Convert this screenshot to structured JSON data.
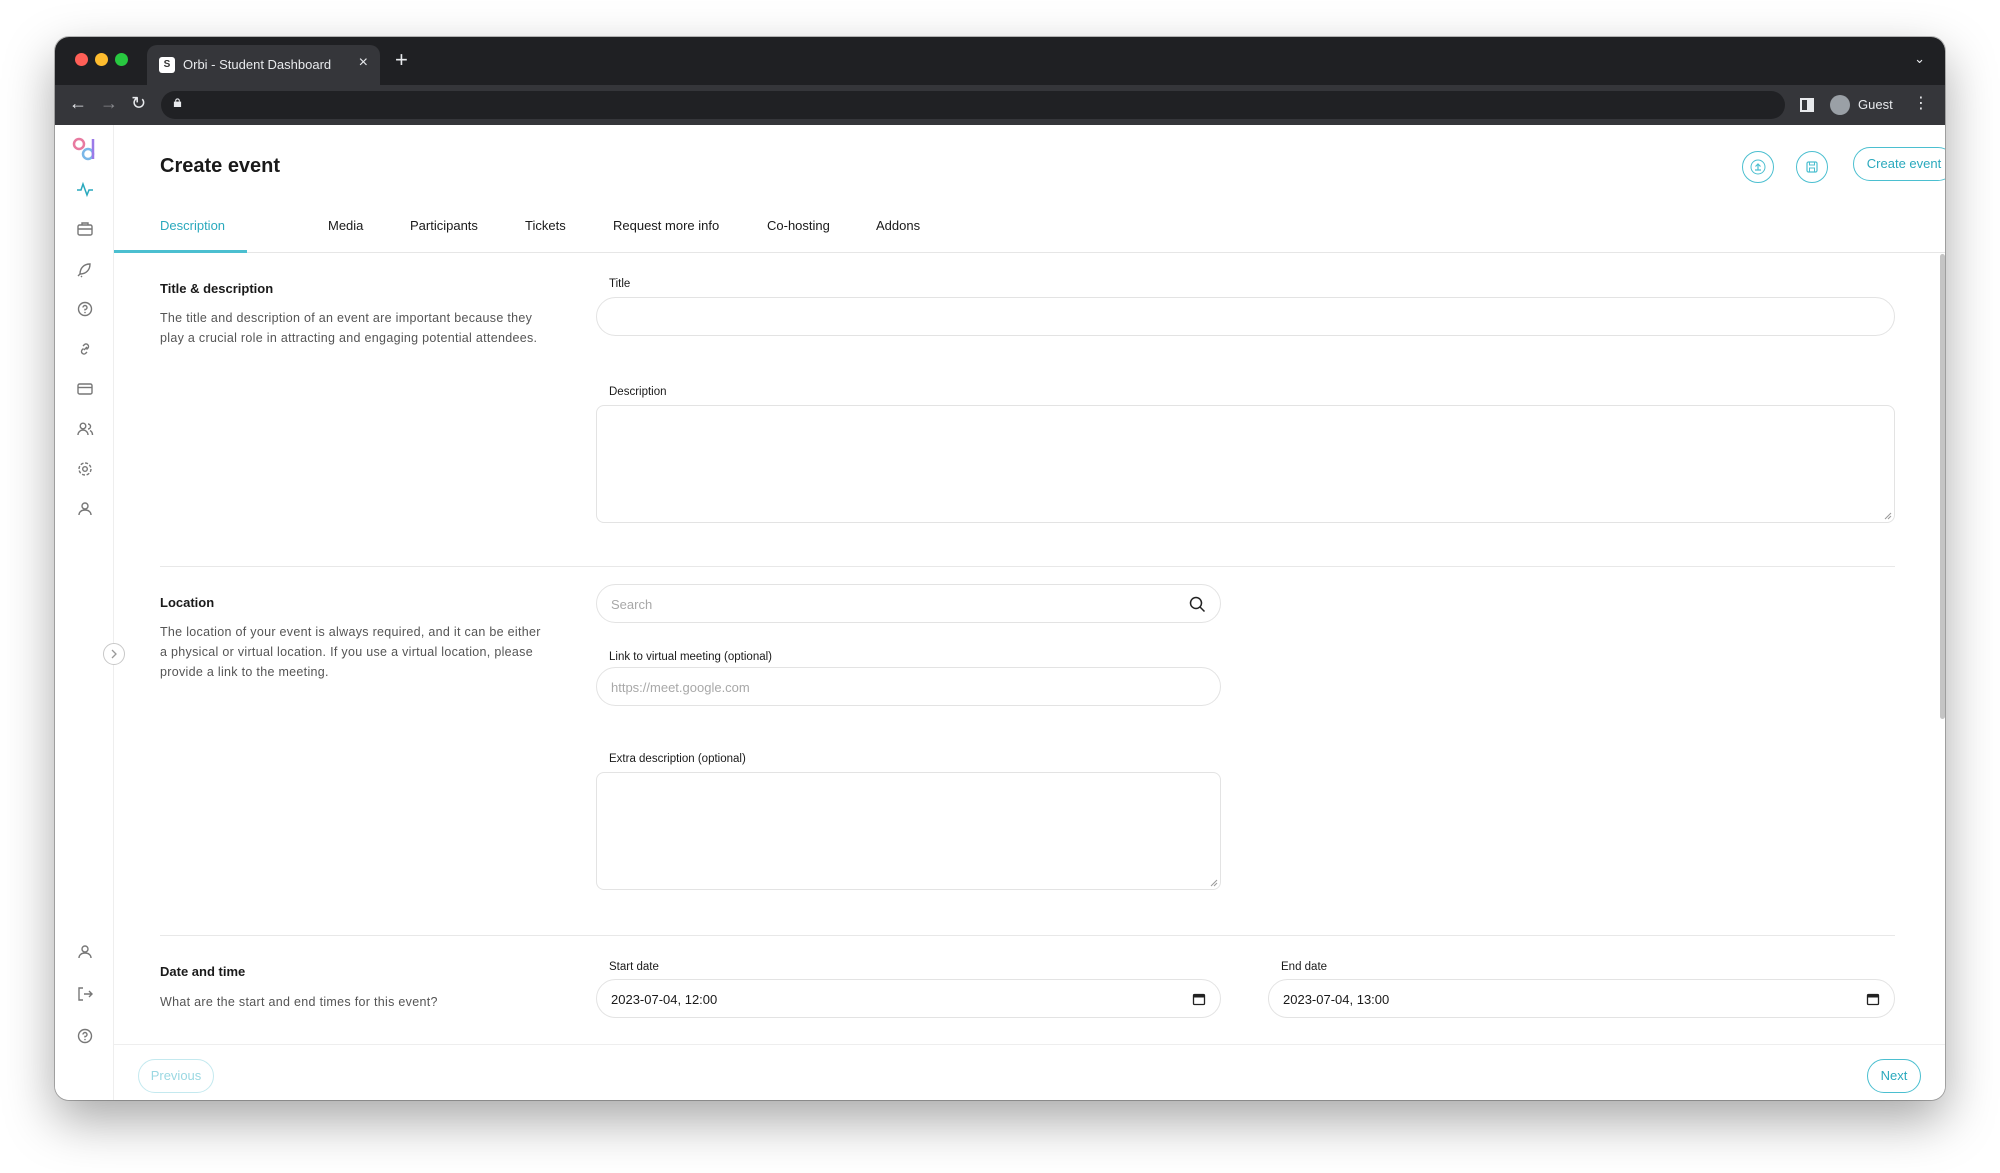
{
  "browser": {
    "tab_title": "Orbi - Student Dashboard",
    "tab_favicon_text": "S",
    "profile_label": "Guest"
  },
  "page": {
    "title": "Create event",
    "create_button": "Create event"
  },
  "tabs": [
    {
      "label": "Description",
      "active": true
    },
    {
      "label": "Media"
    },
    {
      "label": "Participants"
    },
    {
      "label": "Tickets"
    },
    {
      "label": "Request more info"
    },
    {
      "label": "Co-hosting"
    },
    {
      "label": "Addons"
    }
  ],
  "sections": {
    "title_description": {
      "title": "Title & description",
      "desc": "The title and description of an event are important because they play a crucial role in attracting and engaging potential attendees.",
      "title_label": "Title",
      "description_label": "Description"
    },
    "location": {
      "title": "Location",
      "desc": "The location of your event is always required, and it can be either a physical or virtual location. If you use a virtual location, please provide a link to the meeting.",
      "search_placeholder": "Search",
      "link_label": "Link to virtual meeting (optional)",
      "link_placeholder": "https://meet.google.com",
      "extra_label": "Extra description (optional)"
    },
    "date_time": {
      "title": "Date and time",
      "desc": "What are the start and end times for this event?",
      "start_label": "Start date",
      "start_value": "2023-07-04, 12:00",
      "end_label": "End date",
      "end_value": "2023-07-04, 13:00"
    }
  },
  "footer": {
    "previous": "Previous",
    "next": "Next"
  },
  "sidebar_icons": [
    "activity-icon",
    "briefcase-icon",
    "rocket-icon",
    "help-circle-icon",
    "link-icon",
    "credit-card-icon",
    "users-icon",
    "settings-icon",
    "user-icon"
  ],
  "sidebar_bottom_icons": [
    "profile-icon",
    "logout-icon",
    "help-icon"
  ],
  "colors": {
    "accent": "#4bbfd0",
    "accent_text": "#2aa9bd"
  }
}
